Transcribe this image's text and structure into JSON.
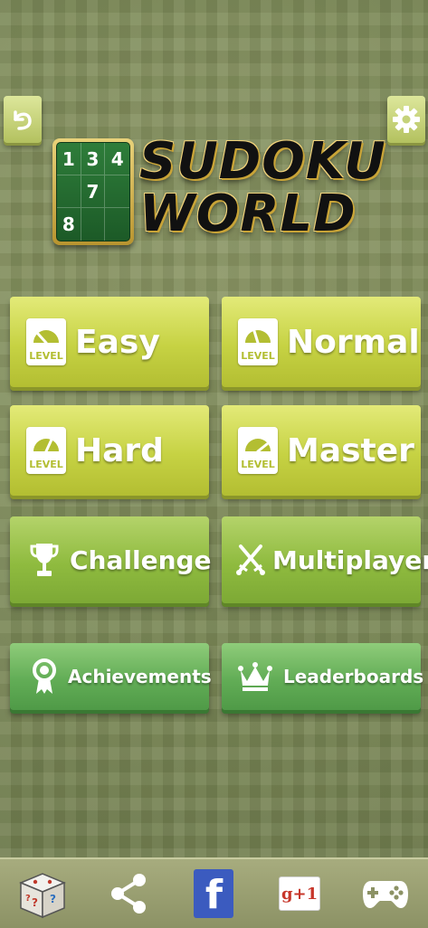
{
  "header": {
    "back_icon": "back-arrow-icon",
    "settings_icon": "gear-icon"
  },
  "logo": {
    "line1": "SUDOKU",
    "line2": "WORLD",
    "board_numbers": [
      "1",
      "3",
      "4",
      "",
      "7",
      "",
      "8",
      "",
      ""
    ]
  },
  "levels": {
    "badge_label": "LEVEL",
    "easy": "Easy",
    "normal": "Normal",
    "hard": "Hard",
    "master": "Master"
  },
  "modes": {
    "challenge": "Challenge",
    "multiplayer": "Multiplayer",
    "achievements": "Achievements",
    "leaderboards": "Leaderboards"
  },
  "bottom_bar": {
    "items": [
      "dice-icon",
      "share-icon",
      "facebook-icon",
      "google-plus-icon",
      "gamepad-icon"
    ],
    "facebook_letter": "f",
    "google_plus_text": "g+1"
  },
  "colors": {
    "level_button": "#c6d243",
    "mode_button": "#8fbb3f",
    "small_button": "#62ad56",
    "background": "#7d8a58"
  }
}
